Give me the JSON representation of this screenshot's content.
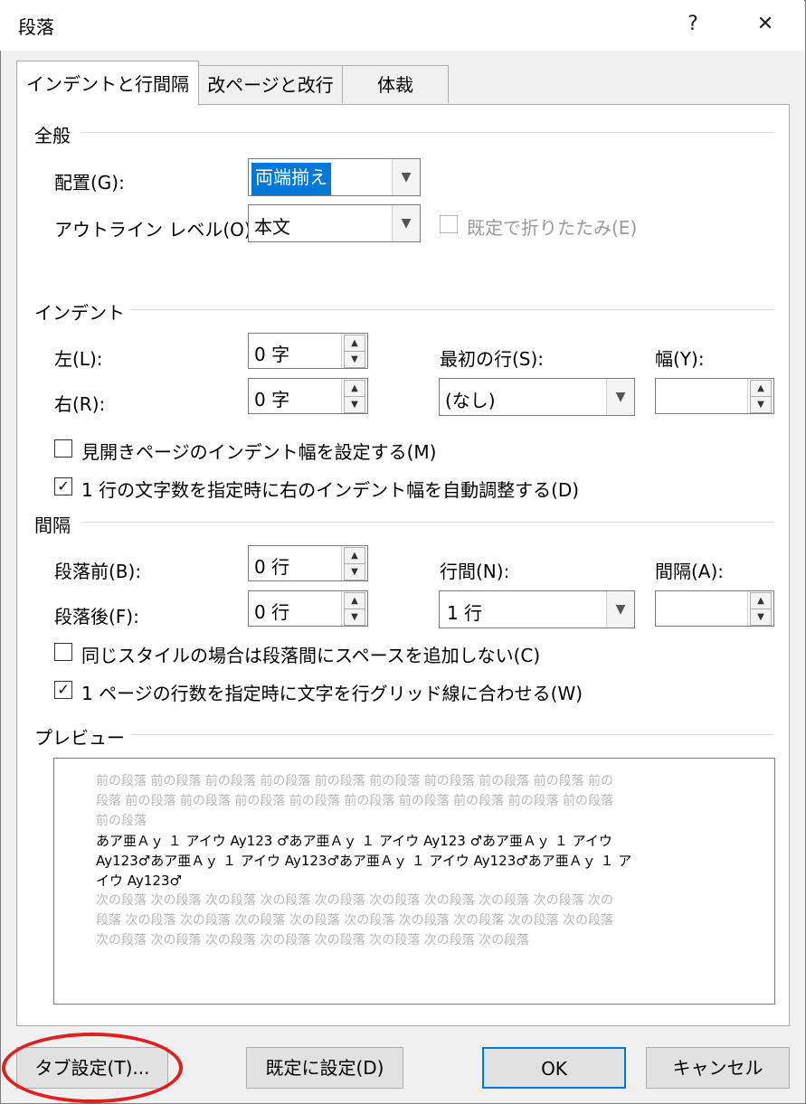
{
  "window": {
    "title": "段落",
    "help": "?",
    "close": "✕"
  },
  "tabs": [
    "インデントと行間隔",
    "改ページと改行",
    "体裁"
  ],
  "general": {
    "section": "全般",
    "alignment_label": "配置(G):",
    "alignment_value": "両端揃え",
    "outline_label": "アウトライン レベル(O):",
    "outline_value": "本文",
    "collapsed_label": "既定で折りたたみ(E)"
  },
  "indent": {
    "section": "インデント",
    "left_label": "左(L):",
    "left_value": "0 字",
    "right_label": "右(R):",
    "right_value": "0 字",
    "first_line_label": "最初の行(S):",
    "first_line_value": "(なし)",
    "width_label": "幅(Y):",
    "width_value": "",
    "mirror_label": "見開きページのインデント幅を設定する(M)",
    "auto_adjust_label": "1 行の文字数を指定時に右のインデント幅を自動調整する(D)"
  },
  "spacing": {
    "section": "間隔",
    "before_label": "段落前(B):",
    "before_value": "0 行",
    "after_label": "段落後(F):",
    "after_value": "0 行",
    "line_label": "行間(N):",
    "line_value": "1 行",
    "at_label": "間隔(A):",
    "at_value": "",
    "no_space_label": "同じスタイルの場合は段落間にスペースを追加しない(C)",
    "grid_label": "1 ページの行数を指定時に文字を行グリッド線に合わせる(W)"
  },
  "preview": {
    "section": "プレビュー",
    "prev_lines": [
      "前の段落 前の段落 前の段落 前の段落 前の段落 前の段落 前の段落 前の段落 前の段落 前の",
      "段落 前の段落 前の段落 前の段落 前の段落 前の段落 前の段落 前の段落 前の段落 前の段落",
      "前の段落"
    ],
    "sample_lines": [
      "あア亜Ａｙ １ アイウ Ay123 ♂あア亜Ａｙ １ アイウ Ay123 ♂あア亜Ａｙ １ アイウ",
      "Ay123♂あア亜Ａｙ １ アイウ Ay123♂あア亜Ａｙ １ アイウ Ay123♂あア亜Ａｙ １ ア",
      "イウ Ay123♂"
    ],
    "next_lines": [
      "次の段落 次の段落 次の段落 次の段落 次の段落 次の段落 次の段落 次の段落 次の段落 次の",
      "段落 次の段落 次の段落 次の段落 次の段落 次の段落 次の段落 次の段落 次の段落 次の段落",
      "次の段落 次の段落 次の段落 次の段落 次の段落 次の段落 次の段落 次の段落"
    ]
  },
  "buttons": {
    "tabs": "タブ設定(T)...",
    "default": "既定に設定(D)",
    "ok": "OK",
    "cancel": "キャンセル"
  },
  "highlight_color": "#e02020"
}
